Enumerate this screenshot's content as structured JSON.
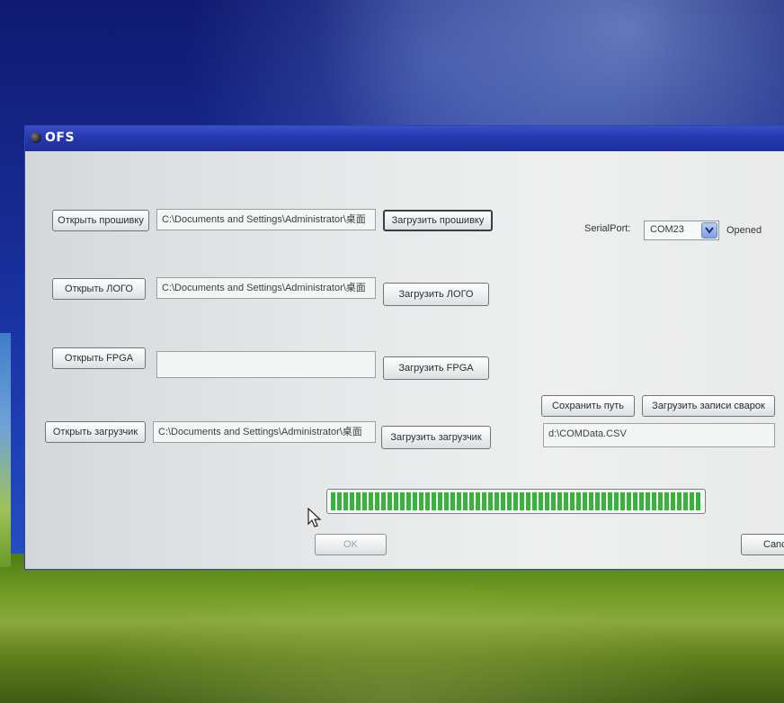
{
  "window": {
    "title": "OFS"
  },
  "rows": [
    {
      "open_label": "Открыть прошивку",
      "path": "C:\\Documents and Settings\\Administrator\\桌面",
      "load_label": "Загрузить прошивку"
    },
    {
      "open_label": "Открыть ЛОГО",
      "path": "C:\\Documents and Settings\\Administrator\\桌面",
      "load_label": "Загрузить ЛОГО"
    },
    {
      "open_label": "Открыть FPGA",
      "path": "",
      "load_label": "Загрузить FPGA"
    },
    {
      "open_label": "Открыть загрузчик",
      "path": "C:\\Documents and Settings\\Administrator\\桌面",
      "load_label": "Загрузить загрузчик"
    }
  ],
  "serial": {
    "label": "SerialPort:",
    "port": "COM23",
    "status": "Opened"
  },
  "records": {
    "save_path_label": "Сохранить путь",
    "load_records_label": "Загрузить записи сварок",
    "file_path": "d:\\COMData.CSV"
  },
  "progress": {
    "percent": 100,
    "color": "#38b23a"
  },
  "footer": {
    "ok_label": "OK",
    "cancel_label": "Canc"
  },
  "icons": {
    "combo_arrow": "chevron-down-icon",
    "window_icon": "app-icon",
    "cursor": "mouse-pointer-icon"
  }
}
